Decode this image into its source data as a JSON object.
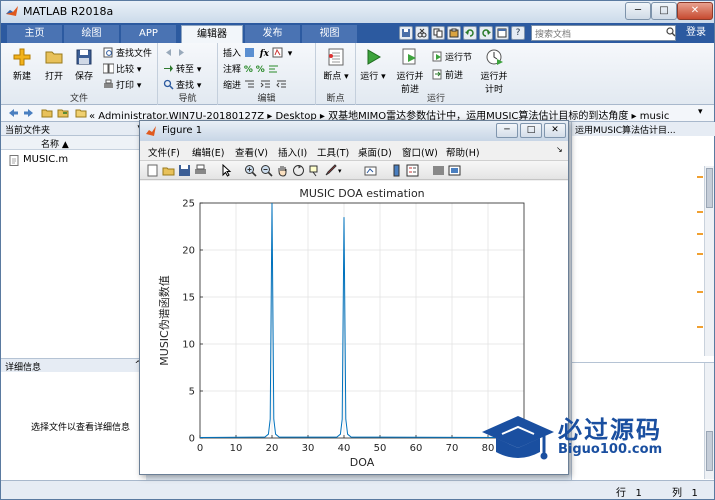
{
  "window": {
    "title": "MATLAB R2018a",
    "min": "─",
    "max": "□",
    "close": "✕"
  },
  "tabs": [
    "主页",
    "绘图",
    "APP",
    "编辑器",
    "发布",
    "视图"
  ],
  "quick_icons": [
    "?"
  ],
  "search": {
    "placeholder": "搜索文档"
  },
  "login_label": "登录",
  "ribbon": {
    "file_group": {
      "label": "文件",
      "new": "新建",
      "open": "打开",
      "save": "保存",
      "find_files": "查找文件",
      "compare": "比较",
      "print": "打印"
    },
    "nav_group": {
      "label": "导航",
      "goto": "转至",
      "find": "查找"
    },
    "edit_group": {
      "label": "编辑",
      "insert": "插入",
      "comment": "注释",
      "indent": "缩进"
    },
    "breakpoint_group": {
      "label": "断点",
      "breakpoints": "断点"
    },
    "run_group": {
      "label": "运行",
      "run": "运行",
      "run_advance": "运行并\n前进",
      "run_section": "运行节",
      "advance": "前进",
      "run_time": "运行并\n计时"
    }
  },
  "address": {
    "path": "«  Administrator.WIN7U-20180127Z  ▸  Desktop  ▸  双基地MIMO雷达参数估计中，运用MUSIC算法估计目标的到达角度  ▸  music"
  },
  "current_folder": {
    "header": "当前文件夹",
    "col_name": "名称 ▲",
    "files": [
      "MUSIC.m"
    ]
  },
  "details": {
    "header": "详细信息",
    "hint": "选择文件以查看详细信息"
  },
  "editor": {
    "tab_label": "运用MUSIC算法估计目..."
  },
  "status": {
    "row_label": "行",
    "row_value": "1",
    "col_label": "列",
    "col_value": "1"
  },
  "figure": {
    "title": "Figure 1",
    "menus": [
      "文件(F)",
      "编辑(E)",
      "查看(V)",
      "插入(I)",
      "工具(T)",
      "桌面(D)",
      "窗口(W)",
      "帮助(H)"
    ]
  },
  "watermark": {
    "cn": "必过源码",
    "en": "Biguo100.com"
  },
  "colors": {
    "accent": "#2c5aa0",
    "line": "#0072bd"
  },
  "chart_data": {
    "type": "line",
    "title": "MUSIC DOA estimation",
    "xlabel": "DOA",
    "ylabel": "MUSIC伪谱函数值",
    "xlim": [
      0,
      90
    ],
    "ylim": [
      0,
      25
    ],
    "xticks": [
      0,
      10,
      20,
      30,
      40,
      50,
      60,
      70,
      80
    ],
    "yticks": [
      0,
      5,
      10,
      15,
      20,
      25
    ],
    "grid": true,
    "series": [
      {
        "x": [
          0,
          18,
          19,
          19.5,
          20,
          20.5,
          21,
          22,
          38,
          39,
          39.5,
          40,
          40.5,
          41,
          42,
          90
        ],
        "y": [
          0.05,
          0.1,
          0.4,
          2,
          25,
          2,
          0.4,
          0.1,
          0.1,
          0.4,
          2,
          23.5,
          2,
          0.4,
          0.1,
          0.05
        ]
      }
    ]
  }
}
